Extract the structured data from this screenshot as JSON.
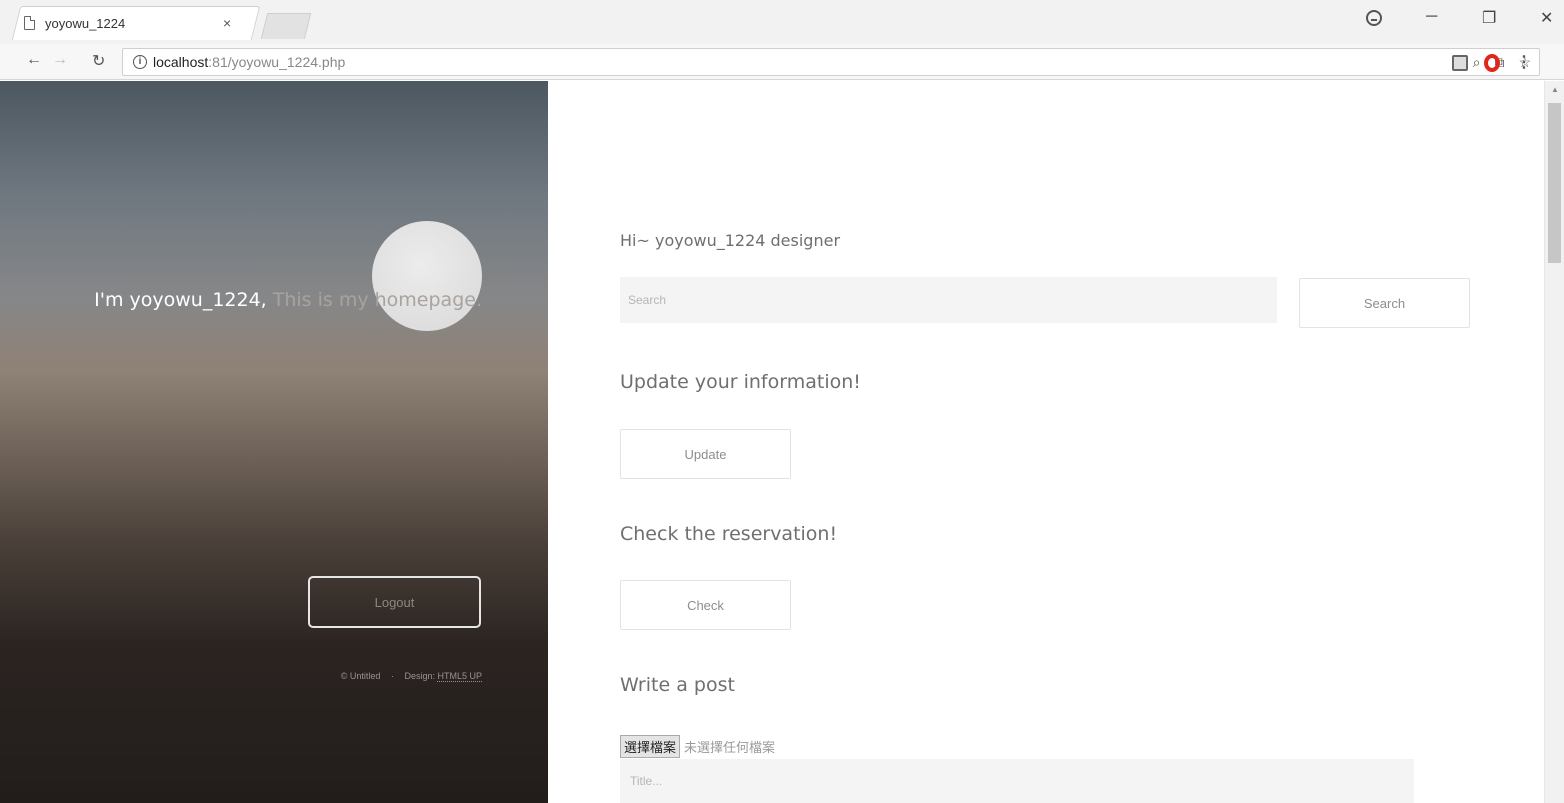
{
  "browser": {
    "tab_title": "yoyowu_1224",
    "tab_close": "×",
    "url_host": "localhost",
    "url_path": ":81/yoyowu_1224.php",
    "window_controls": [
      "profile-icon",
      "minimize-icon",
      "maximize-icon",
      "close-icon"
    ],
    "omnibox_icons": [
      "zoom-icon",
      "translate-icon",
      "bookmark-star-icon"
    ],
    "extensions": [
      "extension-icon",
      "opera-icon",
      "menu-icon"
    ]
  },
  "sidebar": {
    "intro_name": "I'm yoyowu_1224,",
    "intro_rest": " This is my homepage.",
    "logout_label": "Logout",
    "credit_untitled": "© Untitled",
    "credit_design_label": "Design:",
    "credit_design_link": "HTML5 UP"
  },
  "main": {
    "greeting": "Hi~ yoyowu_1224 designer",
    "search_placeholder": "Search",
    "search_button": "Search",
    "update_heading": "Update your information!",
    "update_button": "Update",
    "check_heading": "Check the reservation!",
    "check_button": "Check",
    "post_heading": "Write a post",
    "file_button": "選擇檔案",
    "file_status": "未選擇任何檔案",
    "title_placeholder": "Title..."
  }
}
